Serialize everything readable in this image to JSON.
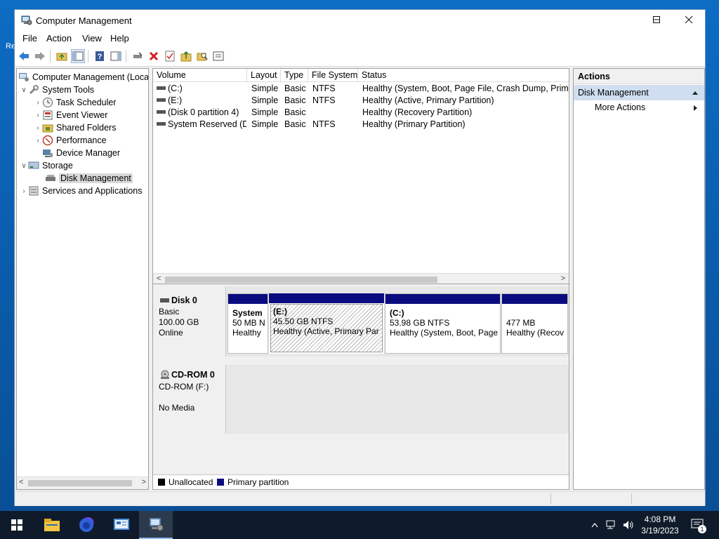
{
  "window": {
    "title": "Computer Management"
  },
  "desktop": {
    "fragment": "Re"
  },
  "menu": [
    "File",
    "Action",
    "View",
    "Help"
  ],
  "tree": {
    "root": "Computer Management (Local",
    "system_tools": "System Tools",
    "task_scheduler": "Task Scheduler",
    "event_viewer": "Event Viewer",
    "shared_folders": "Shared Folders",
    "performance": "Performance",
    "device_manager": "Device Manager",
    "storage": "Storage",
    "disk_management": "Disk Management",
    "services": "Services and Applications"
  },
  "volumes": {
    "columns": [
      "Volume",
      "Layout",
      "Type",
      "File System",
      "Status"
    ],
    "rows": [
      {
        "volume": "(C:)",
        "layout": "Simple",
        "type": "Basic",
        "fs": "NTFS",
        "status": "Healthy (System, Boot, Page File, Crash Dump, Primary P"
      },
      {
        "volume": "(E:)",
        "layout": "Simple",
        "type": "Basic",
        "fs": "NTFS",
        "status": "Healthy (Active, Primary Partition)"
      },
      {
        "volume": "(Disk 0 partition 4)",
        "layout": "Simple",
        "type": "Basic",
        "fs": "",
        "status": "Healthy (Recovery Partition)"
      },
      {
        "volume": "System Reserved (D:)",
        "layout": "Simple",
        "type": "Basic",
        "fs": "NTFS",
        "status": "Healthy (Primary Partition)"
      }
    ]
  },
  "disk0": {
    "name": "Disk 0",
    "type": "Basic",
    "size": "100.00 GB",
    "state": "Online",
    "partitions": [
      {
        "title": "System",
        "line1": "50 MB N",
        "line2": "Healthy"
      },
      {
        "title": "(E:)",
        "line1": "45.50 GB NTFS",
        "line2": "Healthy (Active, Primary Par"
      },
      {
        "title": "(C:)",
        "line1": "53.98 GB NTFS",
        "line2": "Healthy (System, Boot, Page"
      },
      {
        "title": "",
        "line1": "477 MB",
        "line2": "Healthy (Recov"
      }
    ]
  },
  "cdrom0": {
    "name": "CD-ROM 0",
    "drive": "CD-ROM (F:)",
    "media": "No Media"
  },
  "legend": {
    "unallocated": "Unallocated",
    "primary": "Primary partition"
  },
  "actions": {
    "header": "Actions",
    "section": "Disk Management",
    "more": "More Actions"
  },
  "clock": {
    "time": "4:08 PM",
    "date": "3/19/2023"
  },
  "notifications": {
    "count": "1"
  },
  "colors": {
    "partition_bar": "#0b0b80",
    "accent": "#0078d7",
    "taskbar": "#0f1b2a"
  }
}
